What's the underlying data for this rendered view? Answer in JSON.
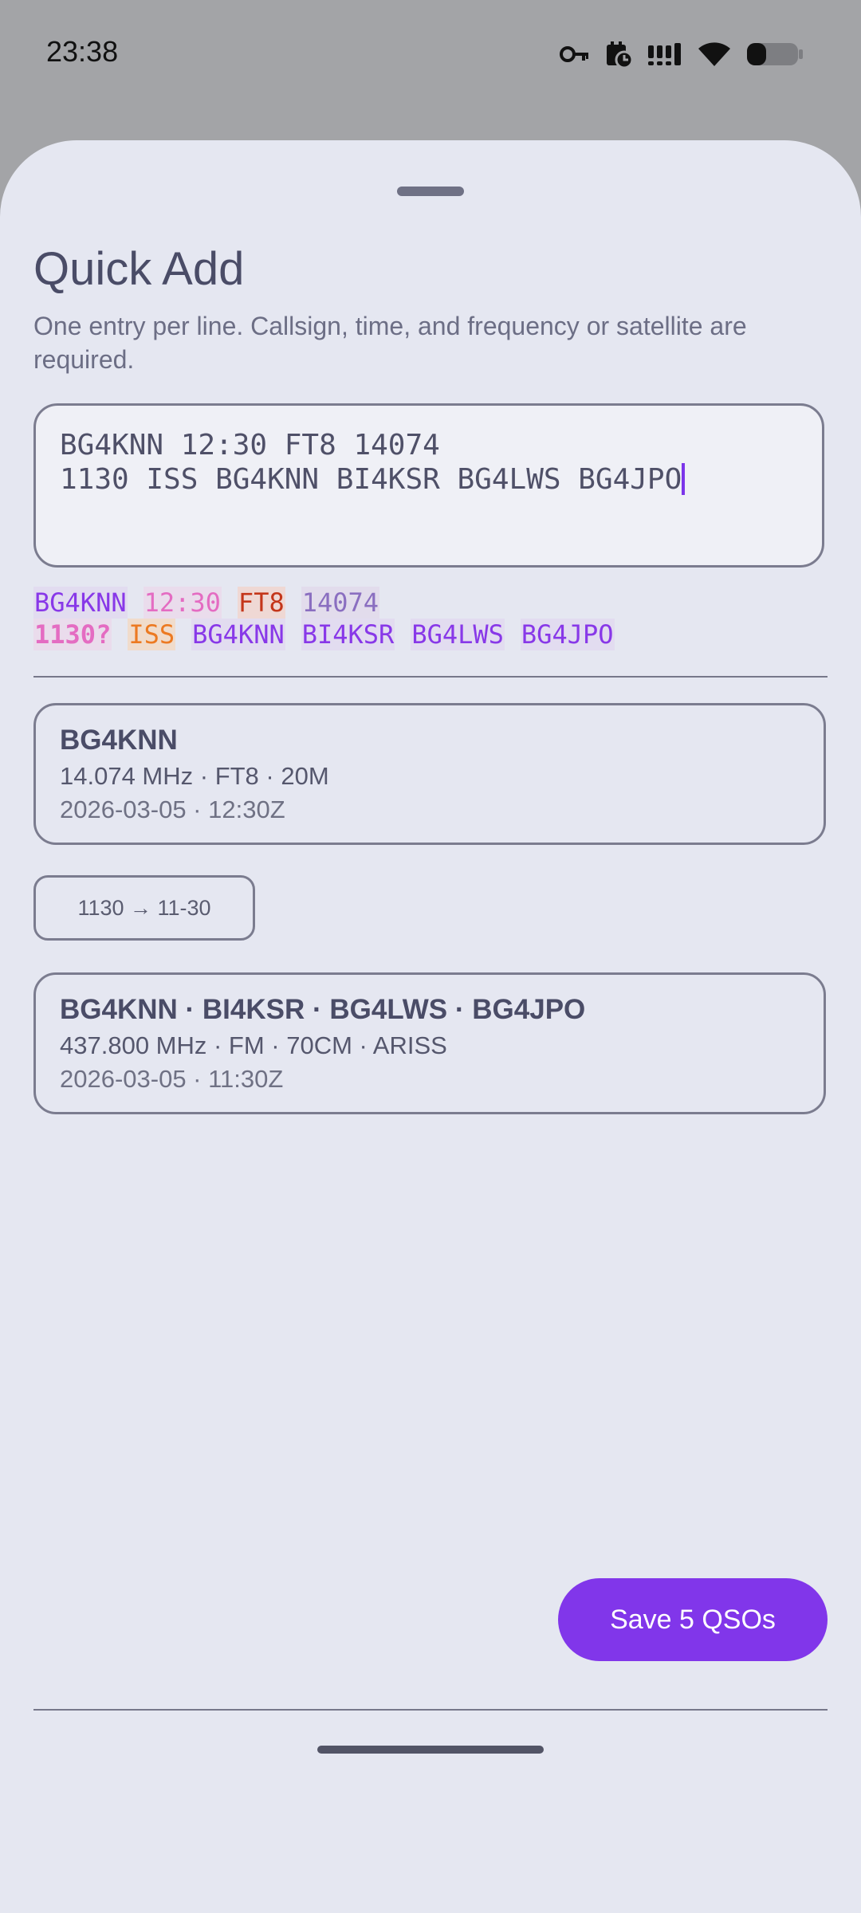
{
  "status_bar": {
    "time": "23:38",
    "icons": [
      "vpn-key-icon",
      "calendar-alarm-icon",
      "signal-icon",
      "wifi-icon",
      "battery-icon"
    ]
  },
  "sheet": {
    "title": "Quick Add",
    "subtitle": "One entry per line. Callsign, time, and frequency or satellite are required.",
    "input_lines": [
      "BG4KNN 12:30 FT8 14074",
      "1130 ISS BG4KNN BI4KSR BG4LWS BG4JPO"
    ],
    "preview": {
      "line1": [
        {
          "text": "BG4KNN",
          "kind": "callsign"
        },
        {
          "text": "12:30",
          "kind": "time"
        },
        {
          "text": "FT8",
          "kind": "mode"
        },
        {
          "text": "14074",
          "kind": "frequency"
        }
      ],
      "line2": [
        {
          "text": "1130?",
          "kind": "ambiguous"
        },
        {
          "text": "ISS",
          "kind": "satellite"
        },
        {
          "text": "BG4KNN",
          "kind": "callsign"
        },
        {
          "text": "BI4KSR",
          "kind": "callsign"
        },
        {
          "text": "BG4LWS",
          "kind": "callsign"
        },
        {
          "text": "BG4JPO",
          "kind": "callsign"
        }
      ]
    },
    "qsos": [
      {
        "calls": "BG4KNN",
        "freq": "14.074 MHz · FT8 · 20M",
        "date": "2026-03-05 · 12:30Z"
      },
      {
        "calls": "BG4KNN · BI4KSR · BG4LWS · BG4JPO",
        "freq": "437.800 MHz · FM · 70CM · ARISS",
        "date": "2026-03-05 · 11:30Z"
      }
    ],
    "time_chip": "1130 → 11-30",
    "save_label": "Save 5 QSOs"
  },
  "colors": {
    "accent": "#8136ea",
    "sheet_bg": "#e5e7f1",
    "scrim": "#a3a4a7"
  }
}
